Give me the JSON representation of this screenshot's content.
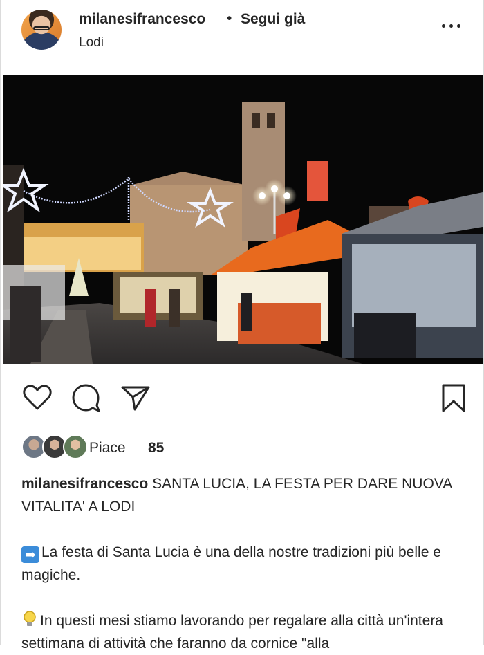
{
  "header": {
    "username": "milanesifrancesco",
    "separator": "•",
    "follow_status": "Segui già",
    "location": "Lodi",
    "more_icon": "more-horizontal-icon"
  },
  "actions": {
    "like_icon": "heart-icon",
    "comment_icon": "comment-icon",
    "share_icon": "send-icon",
    "save_icon": "bookmark-icon"
  },
  "likes": {
    "label": "Piace",
    "count": "85"
  },
  "caption": {
    "username": "milanesifrancesco",
    "title": "SANTA LUCIA, LA FESTA PER DARE NUOVA VITALITA' A LODI",
    "paragraph1_emoji": "➡",
    "paragraph1": "La festa di Santa Lucia è una della nostre tradizioni più belle e magiche.",
    "paragraph2_emoji": "lightbulb-icon",
    "paragraph2": "In questi mesi stiamo lavorando per regalare alla città un'intera settimana di attività che faranno da cornice \"alla"
  },
  "colors": {
    "text": "#262626",
    "border": "#dbdbdb",
    "arrow_emoji_bg": "#3b8cd9"
  }
}
